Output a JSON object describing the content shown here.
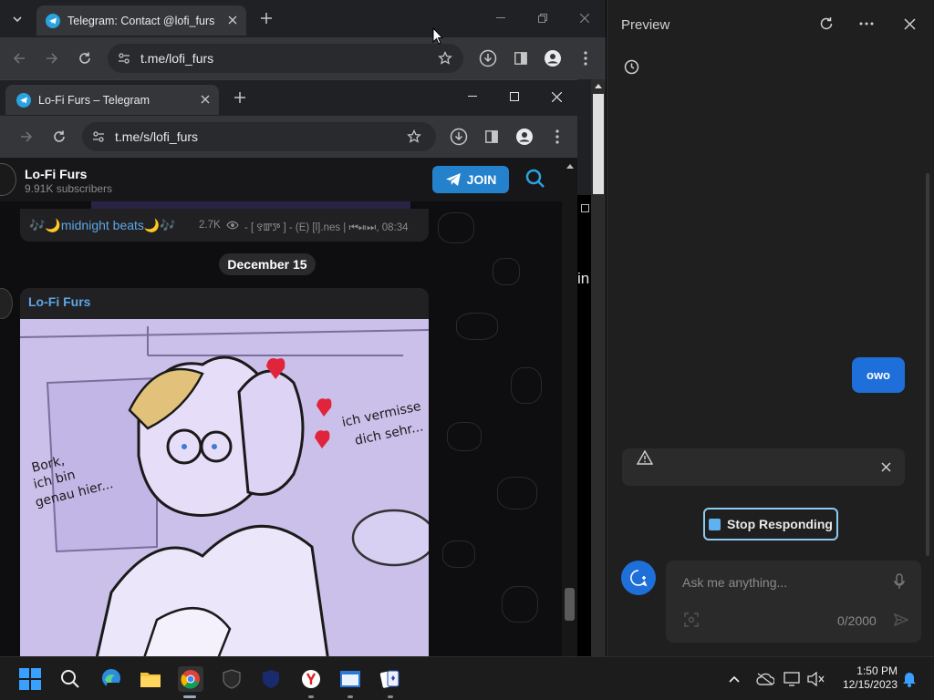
{
  "outer_browser": {
    "tab_title": "Telegram: Contact @lofi_furs",
    "url": "t.me/lofi_furs"
  },
  "inner_browser": {
    "tab_title": "Lo-Fi Furs – Telegram",
    "url": "t.me/s/lofi_furs"
  },
  "channel": {
    "name": "Lo-Fi Furs",
    "subscribers": "9.91K subscribers",
    "join_label": "JOIN"
  },
  "messages": {
    "prev_caption": "🎶🌙midnight beats🌙🎶",
    "prev_views": "2.7K",
    "prev_meta": "- [ ꯱ꯛꯇ ] - (E) [l].nes | ⏮⏯⏭, 08:34",
    "date_label": "December 15",
    "post_author": "Lo-Fi Furs"
  },
  "artwork_text": {
    "left_note_1": "Bork,",
    "left_note_2": "ich bin",
    "left_note_3": "genau hier...",
    "right_note_1": "ich vermisse",
    "right_note_2": "dich sehr..."
  },
  "behind_window": {
    "partial_text": "in"
  },
  "preview_panel": {
    "title": "Preview",
    "user_message": "owo",
    "stop_label": "Stop Responding",
    "input_placeholder": "Ask me anything...",
    "char_counter": "0/2000"
  },
  "taskbar": {
    "time": "1:50 PM",
    "date": "12/15/2023"
  },
  "colors": {
    "telegram_blue": "#2aa3e0",
    "join_button": "#2481cc",
    "accent_blue": "#1e6fd9",
    "link_blue": "#5ea6e5"
  }
}
